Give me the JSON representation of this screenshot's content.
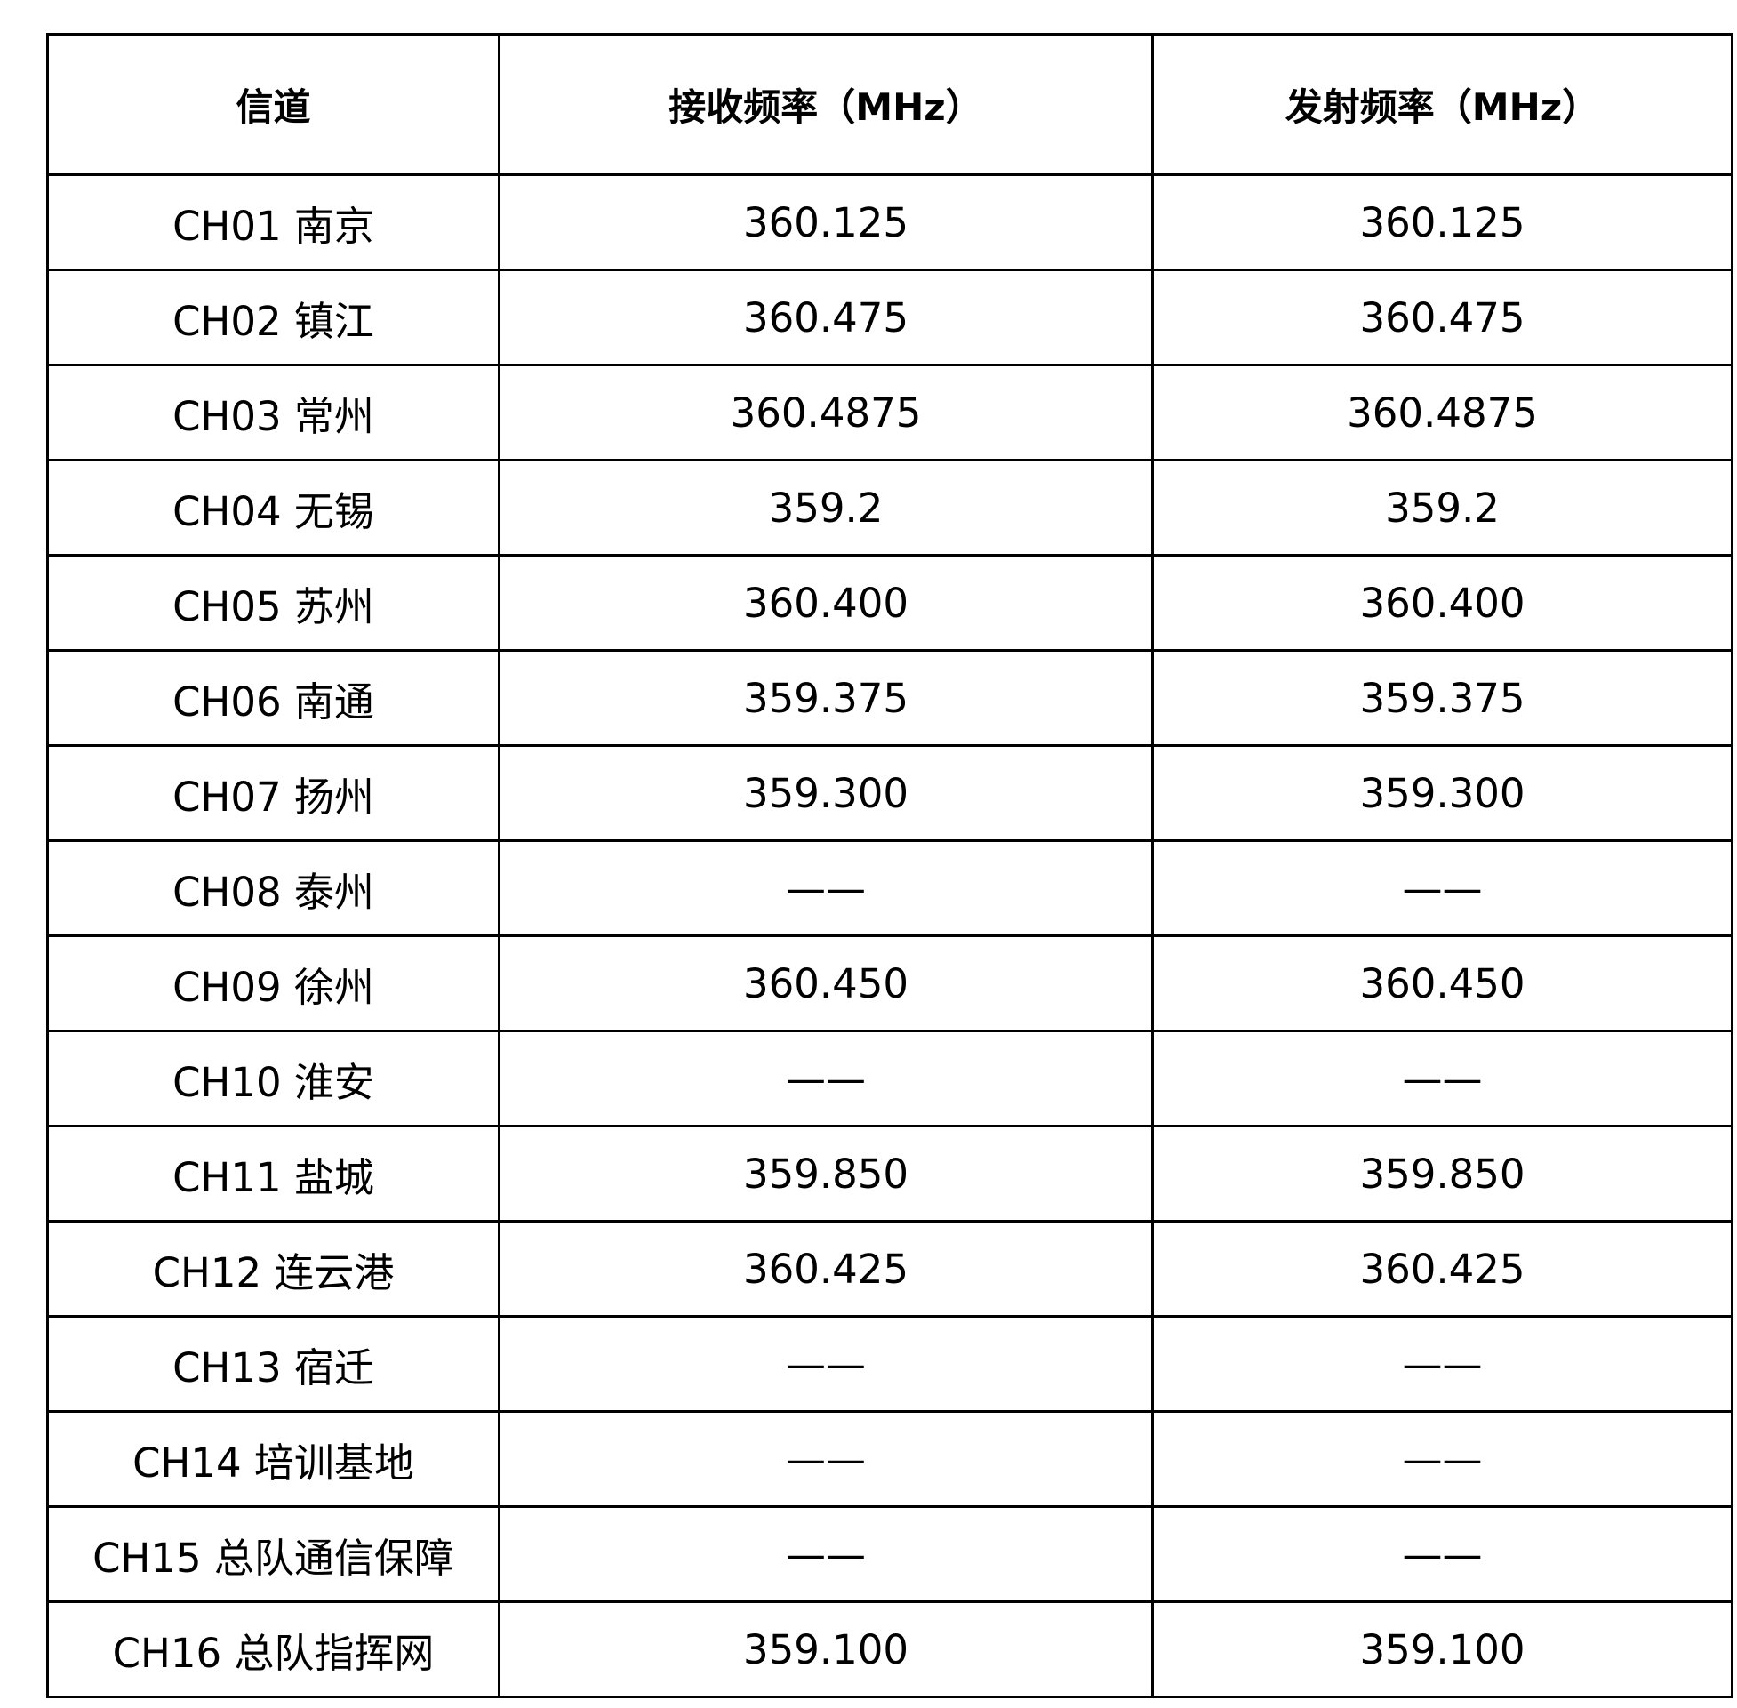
{
  "table": {
    "headers": [
      "信道",
      "接收频率（MHz）",
      "发射频率（MHz）"
    ],
    "rows": [
      {
        "channel": "CH01  南京",
        "rx": "360.125",
        "tx": "360.125"
      },
      {
        "channel": "CH02  镇江",
        "rx": "360.475",
        "tx": "360.475"
      },
      {
        "channel": "CH03  常州",
        "rx": "360.4875",
        "tx": "360.4875"
      },
      {
        "channel": "CH04  无锡",
        "rx": "359.2",
        "tx": "359.2"
      },
      {
        "channel": "CH05  苏州",
        "rx": "360.400",
        "tx": "360.400"
      },
      {
        "channel": "CH06  南通",
        "rx": "359.375",
        "tx": "359.375"
      },
      {
        "channel": "CH07  扬州",
        "rx": "359.300",
        "tx": "359.300"
      },
      {
        "channel": "CH08  泰州",
        "rx": "——",
        "tx": "——"
      },
      {
        "channel": "CH09  徐州",
        "rx": "360.450",
        "tx": "360.450"
      },
      {
        "channel": "CH10  淮安",
        "rx": "——",
        "tx": "——"
      },
      {
        "channel": "CH11  盐城",
        "rx": "359.850",
        "tx": "359.850"
      },
      {
        "channel": "CH12  连云港",
        "rx": "360.425",
        "tx": "360.425"
      },
      {
        "channel": "CH13  宿迁",
        "rx": "——",
        "tx": "——"
      },
      {
        "channel": "CH14  培训基地",
        "rx": "——",
        "tx": "——"
      },
      {
        "channel": "CH15  总队通信保障",
        "rx": "——",
        "tx": "——"
      },
      {
        "channel": "CH16  总队指挥网",
        "rx": "359.100",
        "tx": "359.100"
      }
    ]
  }
}
